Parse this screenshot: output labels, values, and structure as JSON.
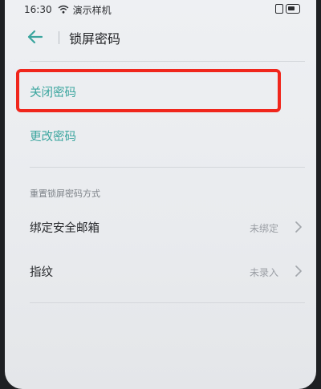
{
  "status_bar": {
    "time": "16:30",
    "carrier": "演示样机"
  },
  "header": {
    "title": "锁屏密码"
  },
  "menu": {
    "close_password": "关闭密码",
    "change_password": "更改密码"
  },
  "reset_section": {
    "label": "重置锁屏密码方式",
    "items": [
      {
        "label": "绑定安全邮箱",
        "value": "未绑定"
      },
      {
        "label": "指纹",
        "value": "未录入"
      }
    ]
  },
  "colors": {
    "accent": "#3aa59e",
    "highlight": "#f0261c"
  }
}
